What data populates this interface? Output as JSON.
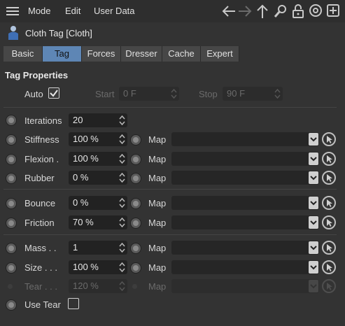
{
  "menu": {
    "mode": "Mode",
    "edit": "Edit",
    "user_data": "User Data"
  },
  "title": "Cloth Tag [Cloth]",
  "tabs": [
    "Basic",
    "Tag",
    "Forces",
    "Dresser",
    "Cache",
    "Expert"
  ],
  "active_tab": "Tag",
  "section": "Tag Properties",
  "auto": {
    "label": "Auto",
    "checked": true
  },
  "start": {
    "label": "Start",
    "value": "0 F"
  },
  "stop": {
    "label": "Stop",
    "value": "90 F"
  },
  "map_label": "Map",
  "params": [
    {
      "label": "Iterations",
      "value": "20"
    },
    {
      "label": "Stiffness",
      "value": "100 %"
    },
    {
      "label": "Flexion .",
      "value": "100 %"
    },
    {
      "label": "Rubber",
      "value": "0 %"
    },
    {
      "label": "Bounce",
      "value": "0 %"
    },
    {
      "label": "Friction",
      "value": "70 %"
    },
    {
      "label": "Mass . .",
      "value": "1"
    },
    {
      "label": "Size . . .",
      "value": "100 %"
    },
    {
      "label": "Tear . . .",
      "value": "120 %"
    }
  ],
  "use_tear": {
    "label": "Use Tear",
    "checked": false
  },
  "colors": {
    "accent": "#5e86b5",
    "background": "#333333",
    "field": "#222222"
  }
}
